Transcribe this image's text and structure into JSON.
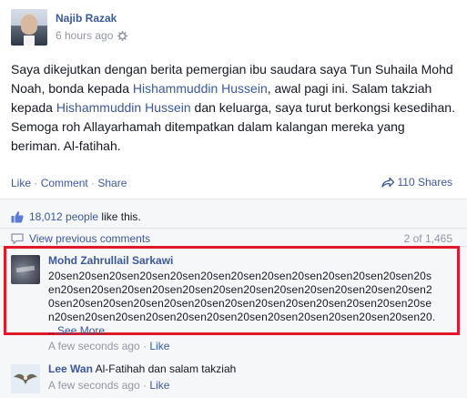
{
  "post": {
    "author": "Najib Razak",
    "time": "6 hours ago",
    "text_part1": "Saya dikejutkan dengan berita pemergian ibu saudara saya Tun Suhaila Mohd Noah, bonda kepada ",
    "mention1": "Hishammuddin Hussein",
    "text_part2": ", awal pagi ini. Salam takziah kepada ",
    "mention2": "Hishammuddin Hussein",
    "text_part3": " dan keluarga, saya turut berkongsi kesedihan. Semoga roh Allayarhamah ditempatkan dalam kalangan mereka yang beriman. Al-fatihah."
  },
  "actions": {
    "like": "Like",
    "separator": " · ",
    "comment": "Comment",
    "share": "Share",
    "shares_count": "110 Shares"
  },
  "likes": {
    "count_link": "18,012 people",
    "suffix": " like this."
  },
  "comments_nav": {
    "view_previous": "View previous comments",
    "count": "2 of 1,465"
  },
  "comments": [
    {
      "author": "Mohd Zahrullail Sarkawi",
      "lines": [
        "20sen20sen20sen20sen20sen20sen20sen20sen20sen20sen20sen20sen20s",
        "en20sen20sen20sen20sen20sen20sen20sen20sen20sen20sen20sen20sen2",
        "0sen20sen20sen20sen20sen20sen20sen20sen20sen20sen20sen20sen20se",
        "n20sen20sen20sen20sen20sen20sen20sen20sen20sen20sen20sen20sen20."
      ],
      "ellipsis": ".. ",
      "see_more": "See More",
      "time": "A few seconds ago",
      "like": "Like"
    },
    {
      "author": "Lee Wan",
      "text": "Al-Fatihah dan salam takziah",
      "time": "A few seconds ago",
      "like": "Like"
    }
  ],
  "colors": {
    "link": "#3b5998",
    "highlight": "#e0192a",
    "muted": "#9197a3"
  }
}
